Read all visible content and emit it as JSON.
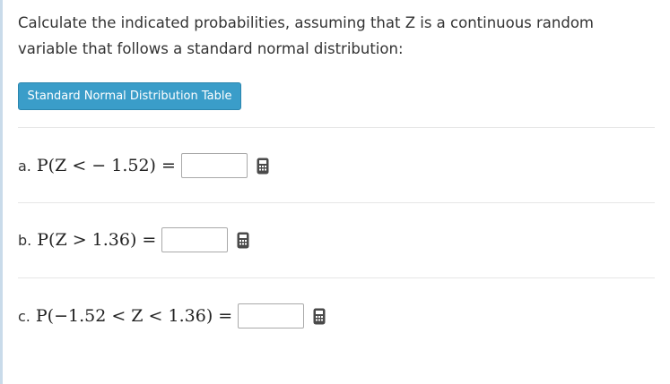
{
  "question": {
    "prompt": "Calculate the indicated probabilities, assuming that Z is a continuous random variable that follows a standard normal distribution:"
  },
  "table_button": {
    "label": "Standard Normal Distribution Table"
  },
  "parts": [
    {
      "letter": "a.",
      "expression": "P(Z < − 1.52) =",
      "answer": ""
    },
    {
      "letter": "b.",
      "expression": "P(Z > 1.36) =",
      "answer": ""
    },
    {
      "letter": "c.",
      "expression": "P(−1.52 < Z < 1.36) =",
      "answer": ""
    }
  ],
  "icons": {
    "keypad": "calculator-keypad-icon"
  },
  "colors": {
    "button_bg": "#3a9dc9",
    "left_rule": "#c9dbea",
    "keypad_icon": "#4a4a4a"
  }
}
